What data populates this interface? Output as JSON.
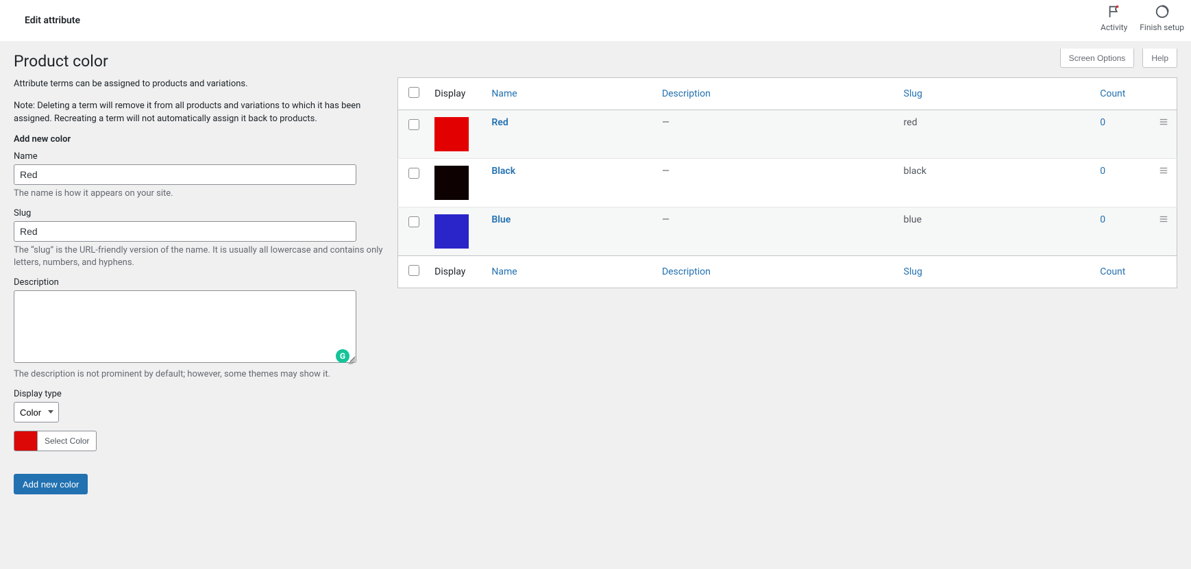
{
  "topbar": {
    "title": "Edit attribute",
    "activity": "Activity",
    "finish_setup": "Finish setup"
  },
  "screen_meta": {
    "options": "Screen Options",
    "help": "Help"
  },
  "page": {
    "heading": "Product color",
    "note1": "Attribute terms can be assigned to products and variations.",
    "note2": "Note: Deleting a term will remove it from all products and variations to which it has been assigned. Recreating a term will not automatically assign it back to products."
  },
  "form": {
    "section_title": "Add new color",
    "name_label": "Name",
    "name_value": "Red",
    "name_desc": "The name is how it appears on your site.",
    "slug_label": "Slug",
    "slug_value": "Red",
    "slug_desc": "The “slug” is the URL-friendly version of the name. It is usually all lowercase and contains only letters, numbers, and hyphens.",
    "desc_label": "Description",
    "desc_value": "",
    "desc_desc": "The description is not prominent by default; however, some themes may show it.",
    "display_label": "Display type",
    "display_value": "Color",
    "select_color": "Select Color",
    "selected_color": "#dc0808",
    "submit": "Add new color"
  },
  "table": {
    "headers": {
      "display": "Display",
      "name": "Name",
      "description": "Description",
      "slug": "Slug",
      "count": "Count"
    },
    "rows": [
      {
        "swatch": "#e30000",
        "name": "Red",
        "desc": "—",
        "slug": "red",
        "count": "0"
      },
      {
        "swatch": "#0e0101",
        "name": "Black",
        "desc": "—",
        "slug": "black",
        "count": "0"
      },
      {
        "swatch": "#2a25c8",
        "name": "Blue",
        "desc": "—",
        "slug": "blue",
        "count": "0"
      }
    ]
  }
}
